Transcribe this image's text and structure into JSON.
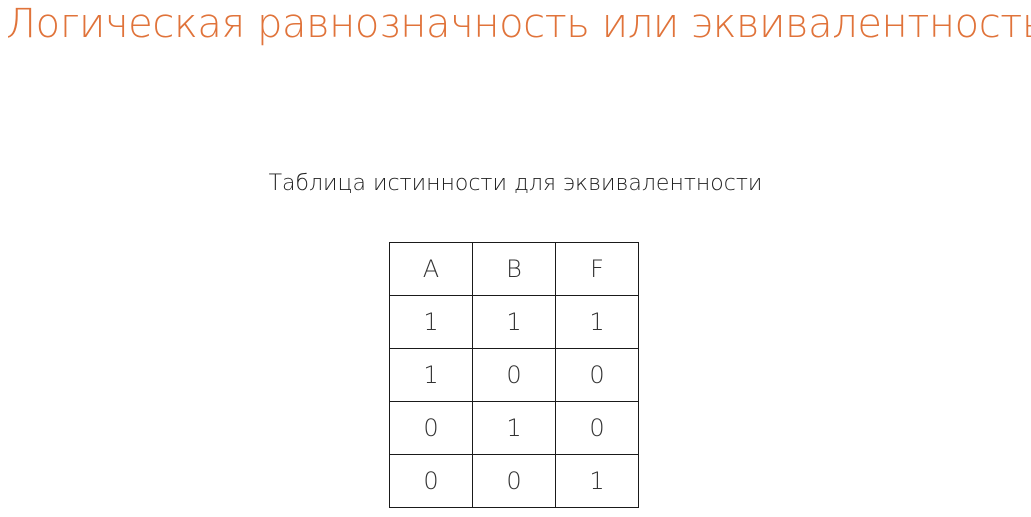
{
  "slide": {
    "title": "Логическая равнозначность или эквивалентность",
    "title_color": "#e0733a"
  },
  "table": {
    "caption": "Таблица истинности для эквивалентности",
    "header": [
      "A",
      "B",
      "F"
    ],
    "rows": [
      [
        "1",
        "1",
        "1"
      ],
      [
        "1",
        "0",
        "0"
      ],
      [
        "0",
        "1",
        "0"
      ],
      [
        "0",
        "0",
        "1"
      ]
    ]
  }
}
